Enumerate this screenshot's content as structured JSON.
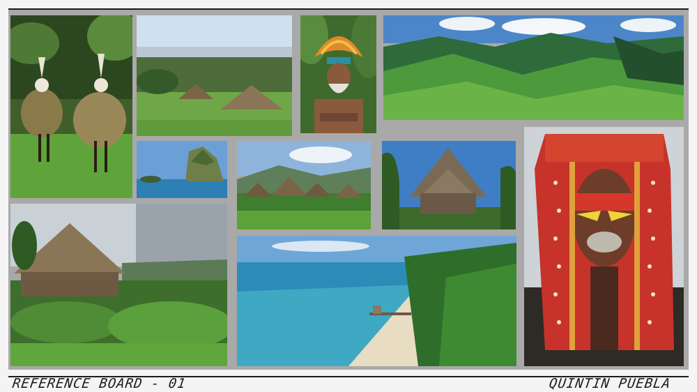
{
  "board": {
    "title": "REFERENCE BOARD - 01",
    "author": "QUINTIN PUEBLA"
  },
  "photos": [
    {
      "id": "dancers",
      "subject": "Two dancers in leaf costumes on grass"
    },
    {
      "id": "highland-hut-valley",
      "subject": "Thatched huts above a misty valley"
    },
    {
      "id": "elder-headdress",
      "subject": "Elder with orange feather headdress"
    },
    {
      "id": "green-mountains",
      "subject": "Aerial view of green mountain ranges"
    },
    {
      "id": "painted-man",
      "subject": "Man with red painted face and dotted headdress"
    },
    {
      "id": "rock-island",
      "subject": "Rock island in blue water"
    },
    {
      "id": "hut-village",
      "subject": "Village of thatched huts on a hillside"
    },
    {
      "id": "spirit-house",
      "subject": "Tall carved spirit house among palms"
    },
    {
      "id": "round-hut-garden",
      "subject": "Round thatched hut in a lush garden"
    },
    {
      "id": "beach-coast",
      "subject": "Turquoise bay with sandy beach and jetty"
    }
  ]
}
